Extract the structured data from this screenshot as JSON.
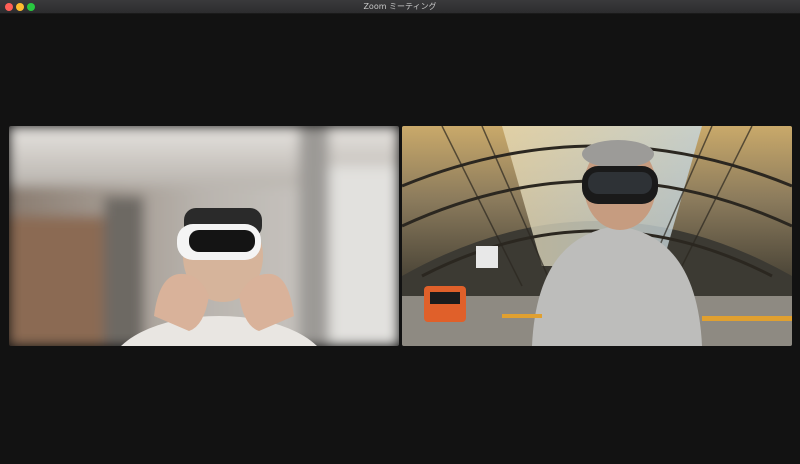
{
  "window": {
    "title": "Zoom ミーティング"
  },
  "meeting": {
    "participants": [
      {
        "id": "left",
        "description_icon": "video-feed-person-icon"
      },
      {
        "id": "right",
        "description_icon": "video-feed-person-icon"
      }
    ]
  },
  "colors": {
    "background": "#121212",
    "titlebar": "#2c2c2e",
    "close": "#ff5f57",
    "minimize": "#febc2e",
    "maximize": "#28c840"
  }
}
